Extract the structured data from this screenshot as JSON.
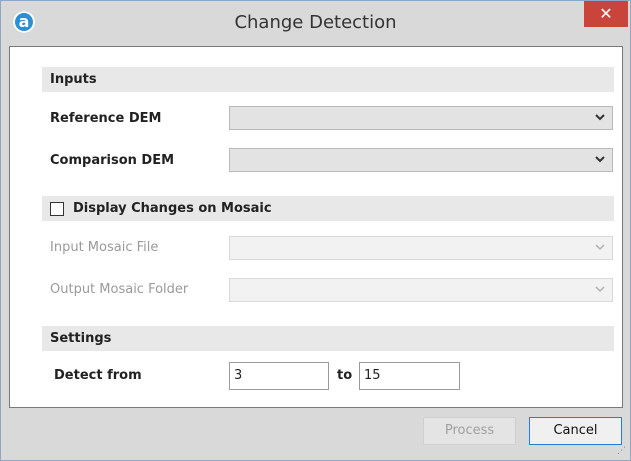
{
  "window": {
    "title": "Change Detection",
    "logo_glyph": "a",
    "close_glyph": "✕"
  },
  "inputs": {
    "header": "Inputs",
    "reference_dem": {
      "label": "Reference DEM",
      "value": ""
    },
    "comparison_dem": {
      "label": "Comparison DEM",
      "value": ""
    }
  },
  "mosaic": {
    "checkbox_label": "Display Changes on Mosaic",
    "checked": false,
    "input_file": {
      "label": "Input Mosaic File",
      "value": "",
      "enabled": false
    },
    "output_folder": {
      "label": "Output Mosaic Folder",
      "value": "",
      "enabled": false
    }
  },
  "settings": {
    "header": "Settings",
    "detect_from_label": "Detect from",
    "from_value": "3",
    "to_label": "to",
    "to_value": "15"
  },
  "buttons": {
    "process_label": "Process",
    "process_enabled": false,
    "cancel_label": "Cancel"
  },
  "icons": {
    "logo": "app-logo-icon",
    "close": "close-icon",
    "dropdown": "chevron-down-icon",
    "resize": "resize-grip-icon"
  },
  "colors": {
    "titlebar": "#d9d9d9",
    "close": "#c9443a",
    "section_header": "#e8e8e8",
    "accent_border": "#2f7bd2"
  }
}
